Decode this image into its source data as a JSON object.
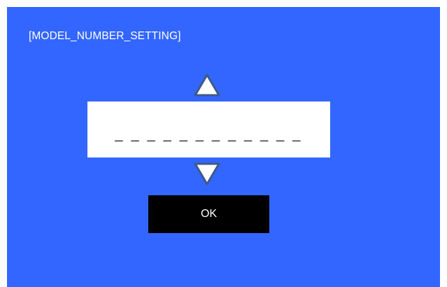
{
  "screen": {
    "title": "[MODEL_NUMBER_SETTING]",
    "background_color": "#3366ff"
  },
  "up_button": {
    "icon": "triangle-up-icon",
    "fill_color": "#ffffff",
    "stroke_color": "#3d5a8a"
  },
  "value_field": {
    "value": "_ _ _ _ _ _ _ _ _ _ _ _",
    "background_color": "#ffffff"
  },
  "down_button": {
    "icon": "triangle-down-icon",
    "fill_color": "#ffffff",
    "stroke_color": "#3d5a8a"
  },
  "ok_button": {
    "label": "OK",
    "background_color": "#000000"
  }
}
